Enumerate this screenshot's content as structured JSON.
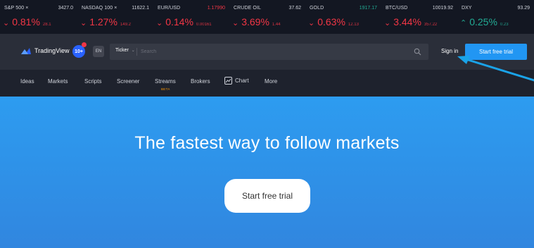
{
  "tickers": [
    {
      "name": "S&P 500 ×",
      "price": "3427.0",
      "price_color": "neutral",
      "direction": "down",
      "change_pct": "0.81%",
      "change_abs": "28.1"
    },
    {
      "name": "NASDAQ 100 ×",
      "price": "11622.1",
      "price_color": "neutral",
      "direction": "down",
      "change_pct": "1.27%",
      "change_abs": "149.2"
    },
    {
      "name": "EUR/USD",
      "price": "1.17990",
      "price_color": "red",
      "direction": "down",
      "change_pct": "0.14%",
      "change_abs": "0.00161"
    },
    {
      "name": "CRUDE OIL",
      "price": "37.62",
      "price_color": "neutral",
      "direction": "down",
      "change_pct": "3.69%",
      "change_abs": "1.44"
    },
    {
      "name": "GOLD",
      "price": "1917.17",
      "price_color": "green",
      "direction": "down",
      "change_pct": "0.63%",
      "change_abs": "12.13"
    },
    {
      "name": "BTC/USD",
      "price": "10019.92",
      "price_color": "neutral",
      "direction": "down",
      "change_pct": "3.44%",
      "change_abs": "357.22"
    },
    {
      "name": "DXY",
      "price": "93.29",
      "price_color": "neutral",
      "direction": "up",
      "change_pct": "0.25%",
      "change_abs": "0.23"
    }
  ],
  "header": {
    "logo_text": "TradingView",
    "notification_count": "10+",
    "language": "EN",
    "ticker_dropdown": "Ticker",
    "search_placeholder": "Search",
    "sign_in": "Sign in",
    "cta": "Start free trial"
  },
  "nav": {
    "items": [
      "Ideas",
      "Markets",
      "Scripts",
      "Screener",
      "Streams",
      "Brokers",
      "Chart",
      "More"
    ],
    "streams_badge": "BETA"
  },
  "hero": {
    "title": "The fastest way to follow markets",
    "cta": "Start free trial"
  },
  "colors": {
    "ticker_bg": "#131722",
    "header_bg": "#2a2e39",
    "nav_bg": "#1e222d",
    "hero_bg": "#2f8fe6",
    "accent": "#2196f3",
    "down": "#f23645",
    "up": "#22ab94",
    "annotation_arrow": "#1aa3e8"
  },
  "icons": {
    "logo": "tradingview-logo-icon",
    "search": "search-icon",
    "chart": "chart-icon",
    "dropdown": "chevron-down-icon"
  }
}
